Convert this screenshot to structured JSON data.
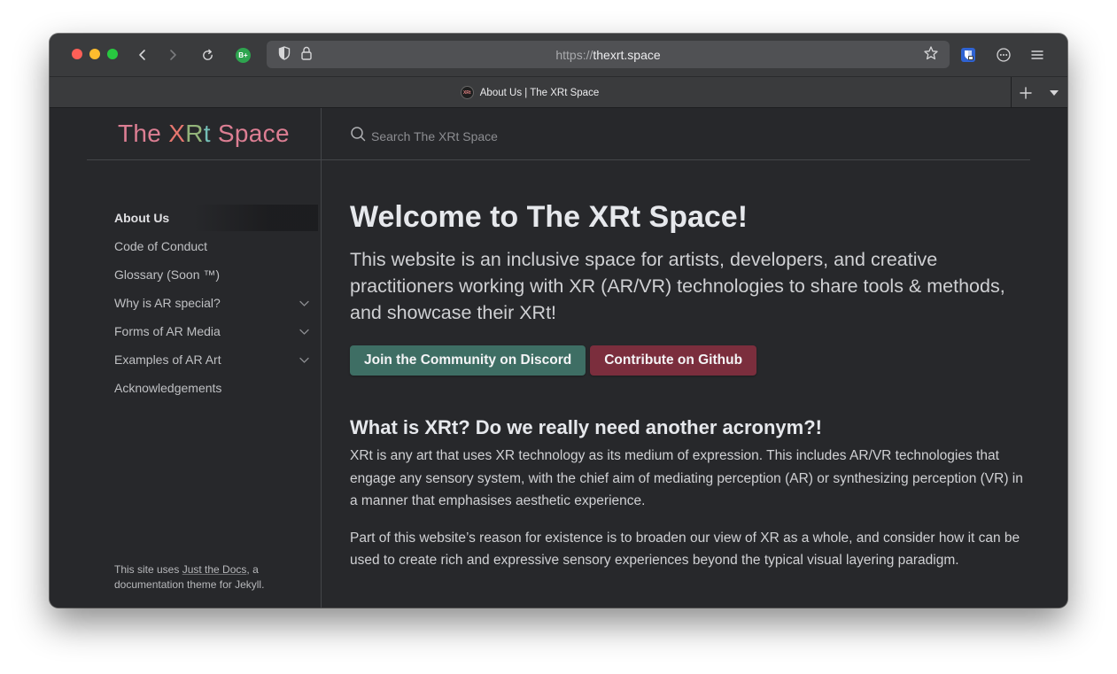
{
  "browser": {
    "url_scheme": "https://",
    "url_host": "thexrt.space",
    "extension_badge": "B+",
    "tab_title": "About Us | The XRt Space",
    "favicon_text": "XRt"
  },
  "site": {
    "title_part1": "The ",
    "title_x": "X",
    "title_r": "R",
    "title_t": "t",
    "title_part2": " Space",
    "search_placeholder": "Search The XRt Space"
  },
  "sidebar": {
    "items": [
      {
        "label": "About Us",
        "active": true,
        "expandable": false
      },
      {
        "label": "Code of Conduct",
        "active": false,
        "expandable": false
      },
      {
        "label": "Glossary (Soon ™)",
        "active": false,
        "expandable": false
      },
      {
        "label": "Why is AR special?",
        "active": false,
        "expandable": true
      },
      {
        "label": "Forms of AR Media",
        "active": false,
        "expandable": true
      },
      {
        "label": "Examples of AR Art",
        "active": false,
        "expandable": true
      },
      {
        "label": "Acknowledgements",
        "active": false,
        "expandable": false
      }
    ],
    "footer_pre": "This site uses ",
    "footer_link": "Just the Docs",
    "footer_post": ", a documentation theme for Jekyll."
  },
  "main": {
    "heading": "Welcome to The XRt Space!",
    "lead": "This website is an inclusive space for artists, developers, and creative practitioners working with XR (AR/VR) technologies to share tools & methods, and showcase their XRt!",
    "discord_button": "Join the Community on Discord",
    "github_button": "Contribute on Github",
    "section_heading": "What is XRt? Do we really need another acronym?!",
    "para1": "XRt is any art that uses XR technology as its medium of expression. This includes AR/VR technologies that engage any sensory system, with the chief aim of mediating perception (AR) or synthesizing perception (VR) in a manner that emphasises aesthetic experience.",
    "para2": "Part of this website’s reason for existence is to broaden our view of XR as a whole, and consider how it can be used to create rich and expressive sensory experiences beyond the typical visual layering paradigm."
  },
  "colors": {
    "discord_button": "#3e6e64",
    "github_button": "#7b2e3d",
    "page_bg": "#27282b"
  }
}
